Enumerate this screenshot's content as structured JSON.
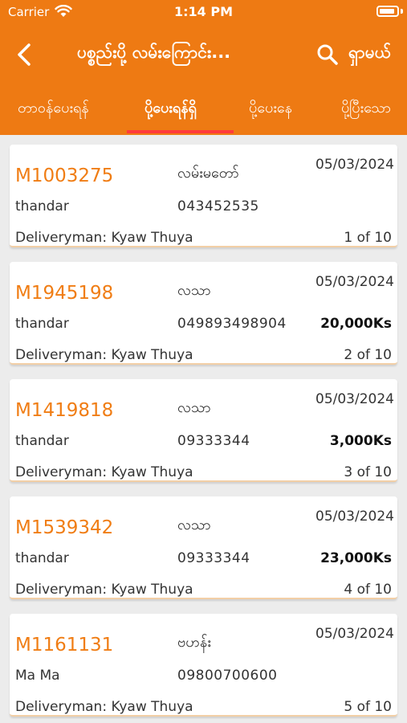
{
  "status_bar": {
    "carrier": "Carrier",
    "time": "1:14 PM"
  },
  "header": {
    "title": "ပစ္စည်းပို့ လမ်းကြောင်း...",
    "search_label": "ရှာမယ်"
  },
  "tabs": [
    {
      "label": "တာဝန်ပေးရန်"
    },
    {
      "label": "ပို့ပေးရန်ရှိ"
    },
    {
      "label": "ပို့ပေးနေ"
    },
    {
      "label": "ပို့ပြီးသော"
    }
  ],
  "selected_tab": "ပို့ပေးရန်ရှိ",
  "colors": {
    "accent": "#ee7a13",
    "order_id": "#f07d14",
    "tab_indicator": "#ff3b3b"
  },
  "orders": [
    {
      "id": "M1003275",
      "recipient": "လမ်းမတော်",
      "date": "05/03/2024",
      "sender": "thandar",
      "phone": "043452535",
      "amount": "",
      "deliveryman": "Deliveryman: Kyaw Thuya",
      "index": "1 of 10"
    },
    {
      "id": "M1945198",
      "recipient": "လသာ",
      "date": "05/03/2024",
      "sender": "thandar",
      "phone": "049893498904",
      "amount": "20,000Ks",
      "deliveryman": "Deliveryman: Kyaw Thuya",
      "index": "2 of 10"
    },
    {
      "id": "M1419818",
      "recipient": "လသာ",
      "date": "05/03/2024",
      "sender": "thandar",
      "phone": "09333344",
      "amount": "3,000Ks",
      "deliveryman": "Deliveryman: Kyaw Thuya",
      "index": "3 of 10"
    },
    {
      "id": "M1539342",
      "recipient": "လသာ",
      "date": "05/03/2024",
      "sender": "thandar",
      "phone": "09333344",
      "amount": "23,000Ks",
      "deliveryman": "Deliveryman: Kyaw Thuya",
      "index": "4 of 10"
    },
    {
      "id": "M1161131",
      "recipient": "ဗဟန်း",
      "date": "05/03/2024",
      "sender": "Ma Ma",
      "phone": "09800700600",
      "amount": "",
      "deliveryman": "Deliveryman: Kyaw Thuya",
      "index": "5 of 10"
    }
  ]
}
